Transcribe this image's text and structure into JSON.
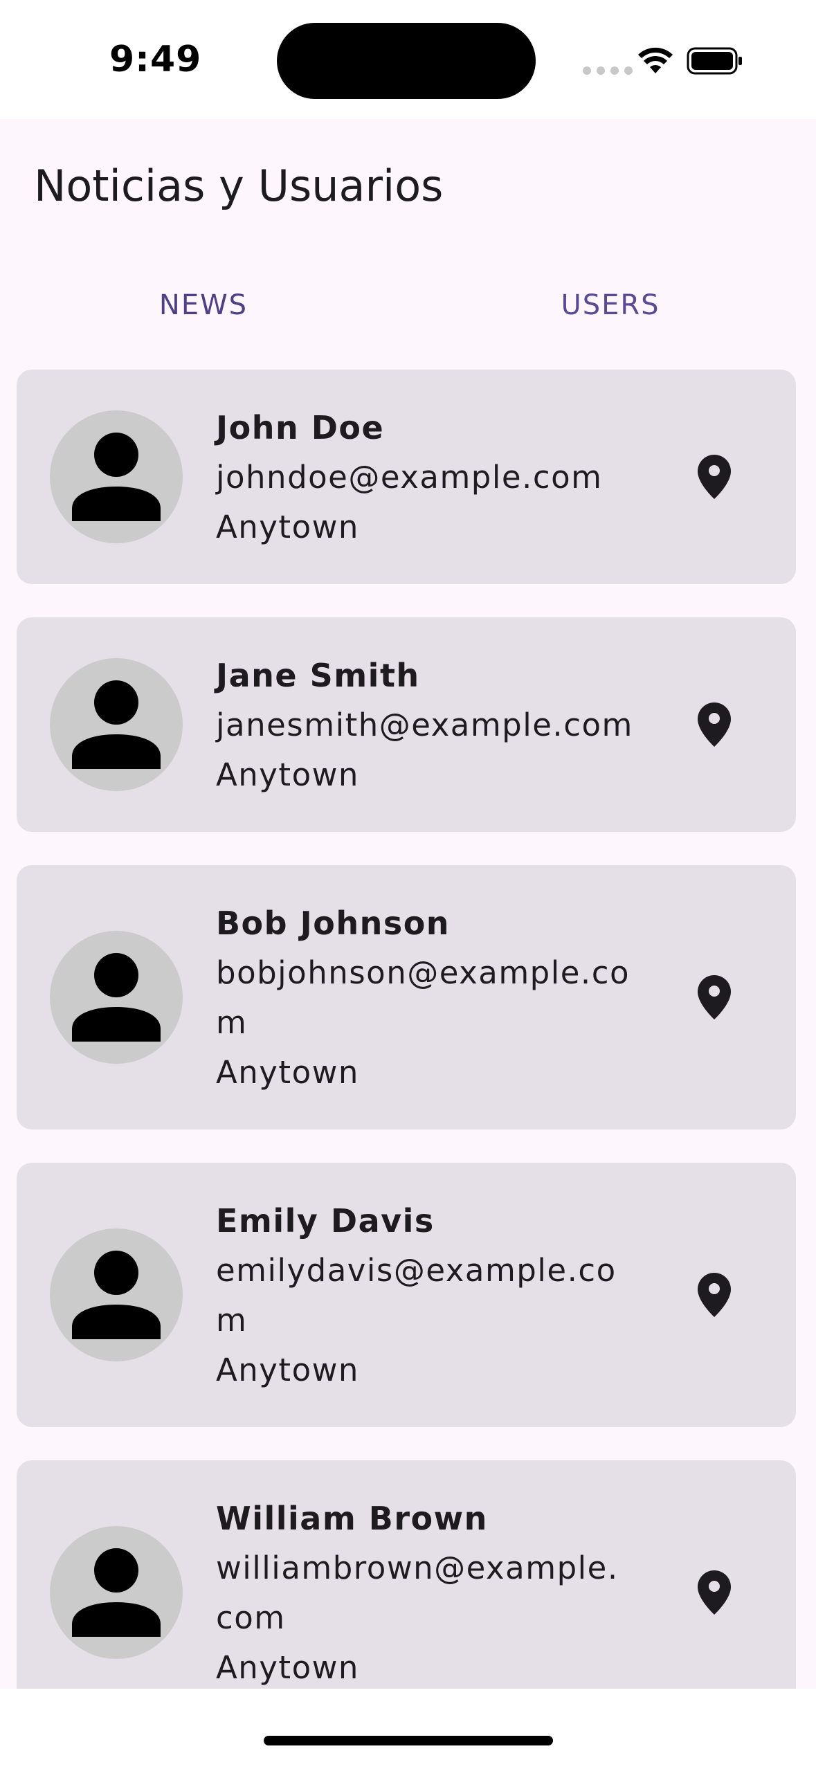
{
  "status_bar": {
    "time": "9:49"
  },
  "app_bar": {
    "title": "Noticias y Usuarios"
  },
  "tabs": [
    {
      "label": "NEWS",
      "selected": false
    },
    {
      "label": "USERS",
      "selected": true
    }
  ],
  "users": [
    {
      "name": "John Doe",
      "email": "johndoe@example.com",
      "city": "Anytown"
    },
    {
      "name": "Jane Smith",
      "email": "janesmith@example.com",
      "city": "Anytown"
    },
    {
      "name": "Bob Johnson",
      "email": "bobjohnson@example.com",
      "city": "Anytown"
    },
    {
      "name": "Emily Davis",
      "email": "emilydavis@example.com",
      "city": "Anytown"
    },
    {
      "name": "William Brown",
      "email": "williambrown@example.com",
      "city": "Anytown"
    }
  ],
  "icons": {
    "avatar": "person-icon",
    "location": "location-pin-icon"
  },
  "colors": {
    "primary": "#6750a4",
    "surface": "#fdf7fd",
    "card": "#e5e0e7",
    "avatar_bg": "#cbcbcb"
  }
}
